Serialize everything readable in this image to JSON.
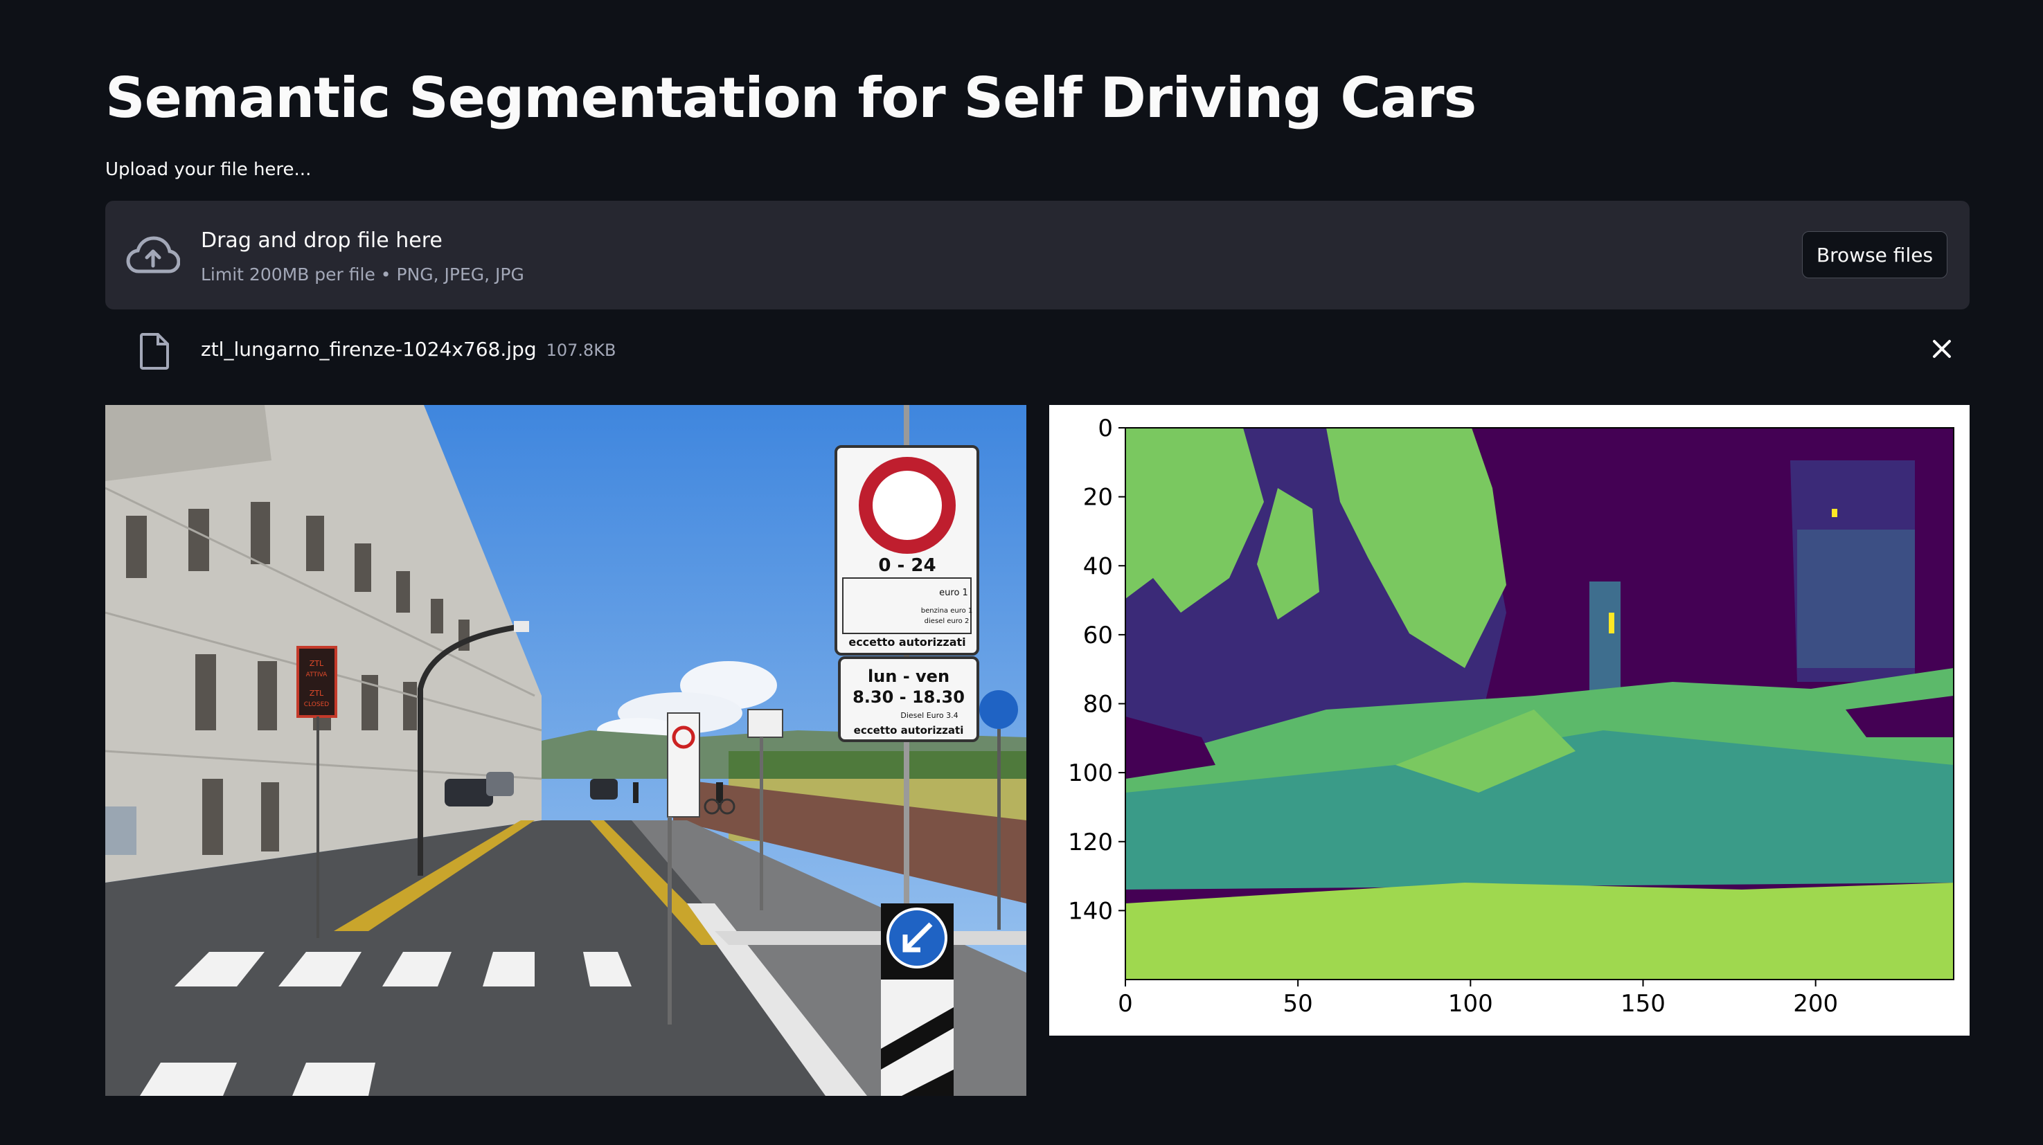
{
  "page": {
    "title": "Semantic Segmentation for Self Driving Cars"
  },
  "uploader": {
    "label": "Upload your file here...",
    "drop_title": "Drag and drop file here",
    "drop_hint": "Limit 200MB per file • PNG, JPEG, JPG",
    "browse_label": "Browse files",
    "icon": "cloud-upload-icon"
  },
  "uploaded_file": {
    "name": "ztl_lungarno_firenze-1024x768.jpg",
    "size": "107.8KB",
    "icon": "file-icon",
    "remove_icon": "close-icon"
  },
  "photo": {
    "sign_top": "0 - 24",
    "sign_euro1": "euro 1",
    "sign_benzina": "benzina euro 1",
    "sign_diesel2": "diesel euro 2",
    "sign_eccetto": "eccetto autorizzati",
    "sign_lunven": "lun - ven",
    "sign_hours": "8.30 - 18.30",
    "sign_diesel34": "Diesel Euro 3.4",
    "sign_eccetto2": "eccetto autorizzati",
    "ztl_1": "ZTL",
    "ztl_2": "ATTIVA",
    "ztl_3": "ZTL",
    "ztl_4": "CLOSED"
  },
  "chart_data": {
    "type": "heatmap",
    "title": "",
    "xlabel": "",
    "ylabel": "",
    "xlim": [
      0,
      240
    ],
    "ylim": [
      160,
      0
    ],
    "x_ticks": [
      0,
      50,
      100,
      150,
      200
    ],
    "y_ticks": [
      0,
      20,
      40,
      60,
      80,
      100,
      120,
      140
    ],
    "colormap": "viridis",
    "colors": {
      "sky_building": "#440154",
      "structure": "#3b2a78",
      "pole_sign": "#3e6e8e",
      "road": "#3a9b88",
      "sidewalk": "#5cb96a",
      "vegetation": "#7ac860",
      "terrain": "#9fd84f",
      "marking": "#fde725"
    }
  }
}
